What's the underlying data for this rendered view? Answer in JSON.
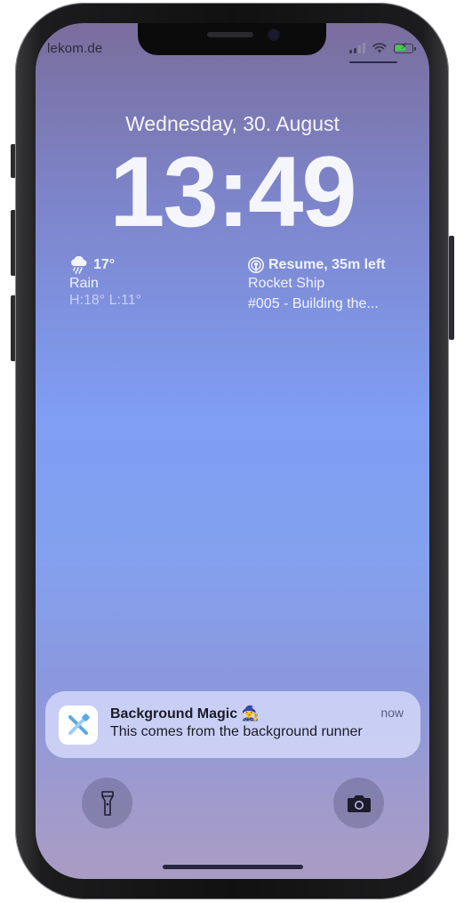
{
  "status_bar": {
    "carrier": "lekom.de"
  },
  "lock_screen": {
    "date": "Wednesday, 30. August",
    "time": "13:49"
  },
  "widgets": {
    "weather": {
      "icon": "cloud-rain-icon",
      "temperature": "17°",
      "condition": "Rain",
      "range": "H:18° L:11°"
    },
    "podcast": {
      "icon": "podcast-icon",
      "status": "Resume, 35m left",
      "show": "Rocket Ship",
      "episode": "#005 - Building the..."
    }
  },
  "notification": {
    "app_icon": "tools-icon",
    "title": "Background Magic 🧙",
    "body": "This comes from the background runner",
    "time": "now"
  },
  "quick_actions": {
    "left": "flashlight-icon",
    "right": "camera-icon"
  },
  "colors": {
    "notification_bg": "#d6dafa",
    "battery_fill": "#3fd13f",
    "app_icon_accent": "#5aa7e6"
  }
}
